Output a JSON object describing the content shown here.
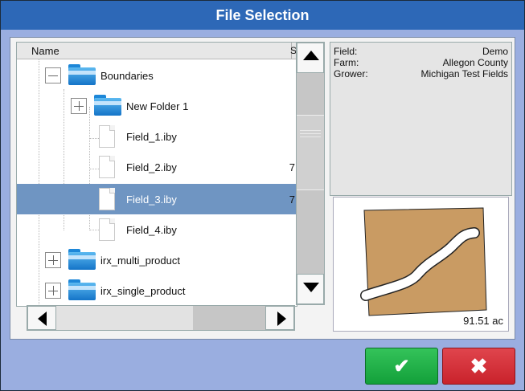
{
  "window": {
    "title": "File Selection"
  },
  "tree": {
    "header": {
      "name_label": "Name",
      "cut_label": "S"
    },
    "rows": [
      {
        "label": "Boundaries",
        "type": "folder",
        "expanded": true,
        "cut": ""
      },
      {
        "label": "New Folder 1",
        "type": "folder",
        "expanded": false,
        "cut": ""
      },
      {
        "label": "Field_1.iby",
        "type": "file",
        "cut": ""
      },
      {
        "label": "Field_2.iby",
        "type": "file",
        "cut": "7"
      },
      {
        "label": "Field_3.iby",
        "type": "file",
        "cut": "7",
        "selected": true
      },
      {
        "label": "Field_4.iby",
        "type": "file",
        "cut": ""
      },
      {
        "label": "irx_multi_product",
        "type": "folder",
        "expanded": false,
        "cut": ""
      },
      {
        "label": "irx_single_product",
        "type": "folder",
        "expanded": false,
        "cut": ""
      }
    ]
  },
  "info": {
    "field_key": "Field:",
    "field_value": "Demo",
    "farm_key": "Farm:",
    "farm_value": "Allegon County",
    "grower_key": "Grower:",
    "grower_value": "Michigan Test Fields"
  },
  "map": {
    "acres": "91.51 ac",
    "field_color": "#c99b63",
    "channel_color": "#ffffff"
  },
  "buttons": {
    "ok_icon": "check-icon",
    "cancel_icon": "x-icon"
  },
  "colors": {
    "title_bar": "#2d68b7",
    "selection": "#6f95c2",
    "ok": "#1fae45",
    "cancel": "#d12f37"
  }
}
